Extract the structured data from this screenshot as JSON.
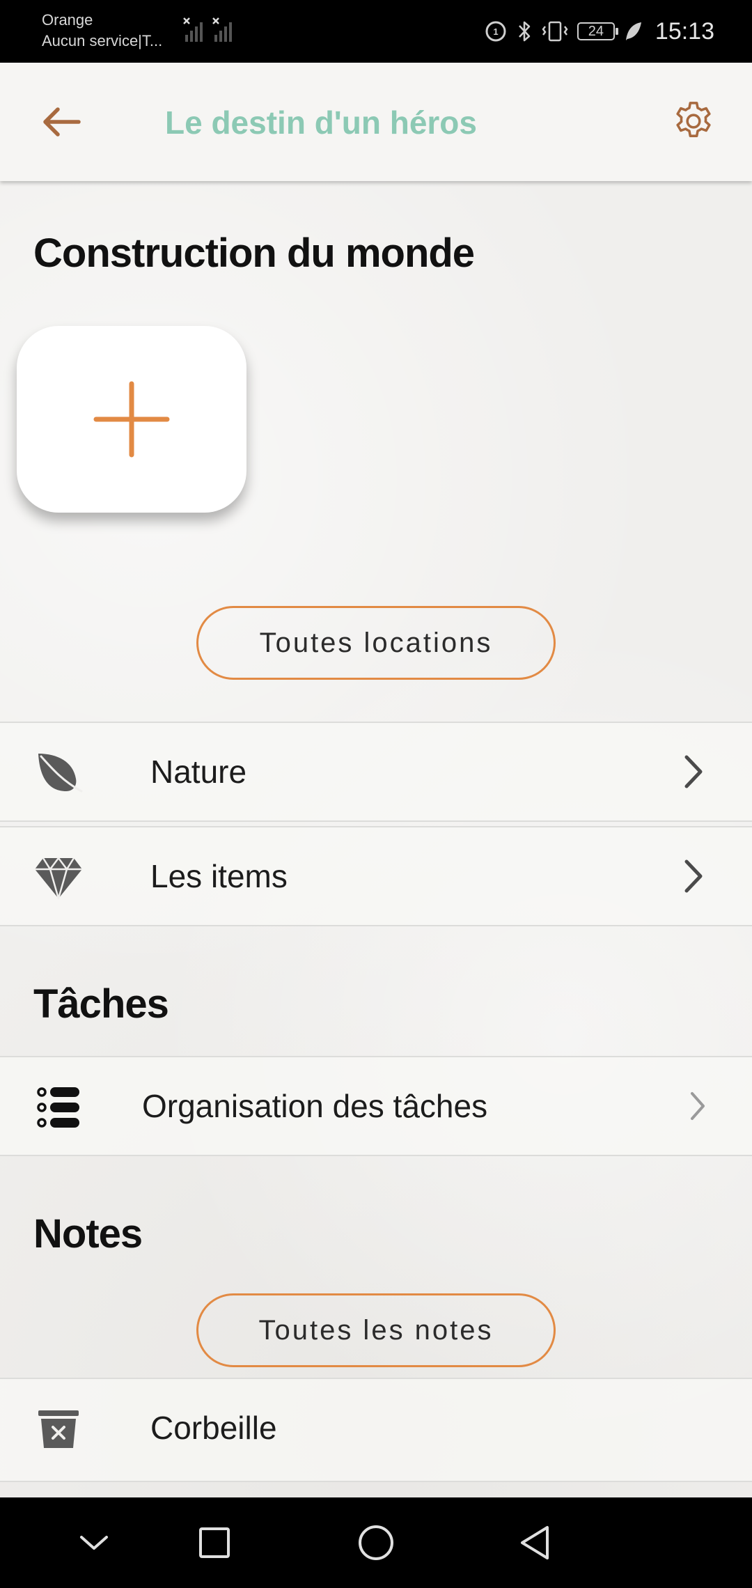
{
  "status_bar": {
    "carrier_name": "Orange",
    "carrier_status": "Aucun service|T...",
    "battery_level": "24",
    "time": "15:13"
  },
  "app_bar": {
    "title": "Le destin d'un héros",
    "title_color": "#8cc9b4",
    "back_icon": "arrow-left-icon",
    "settings_icon": "gear-icon"
  },
  "world_building": {
    "title": "Construction du monde",
    "add_icon": "plus-icon",
    "all_locations_label": "Toutes locations",
    "items": [
      {
        "label": "Nature",
        "icon": "leaf-icon"
      },
      {
        "label": "Les items",
        "icon": "diamond-icon"
      }
    ]
  },
  "tasks": {
    "title": "Tâches",
    "items": [
      {
        "label": "Organisation des tâches",
        "icon": "task-list-icon"
      }
    ]
  },
  "notes": {
    "title": "Notes",
    "all_notes_label": "Toutes les notes",
    "items": [
      {
        "label": "Corbeille",
        "icon": "trash-icon"
      }
    ]
  },
  "colors": {
    "accent": "#e28a44",
    "icon_gray": "#5a5a5a",
    "brown_icon": "#a86a3f"
  },
  "nav_bar": {
    "icons": [
      "chevron-down-icon",
      "square-icon",
      "circle-icon",
      "triangle-back-icon"
    ]
  }
}
